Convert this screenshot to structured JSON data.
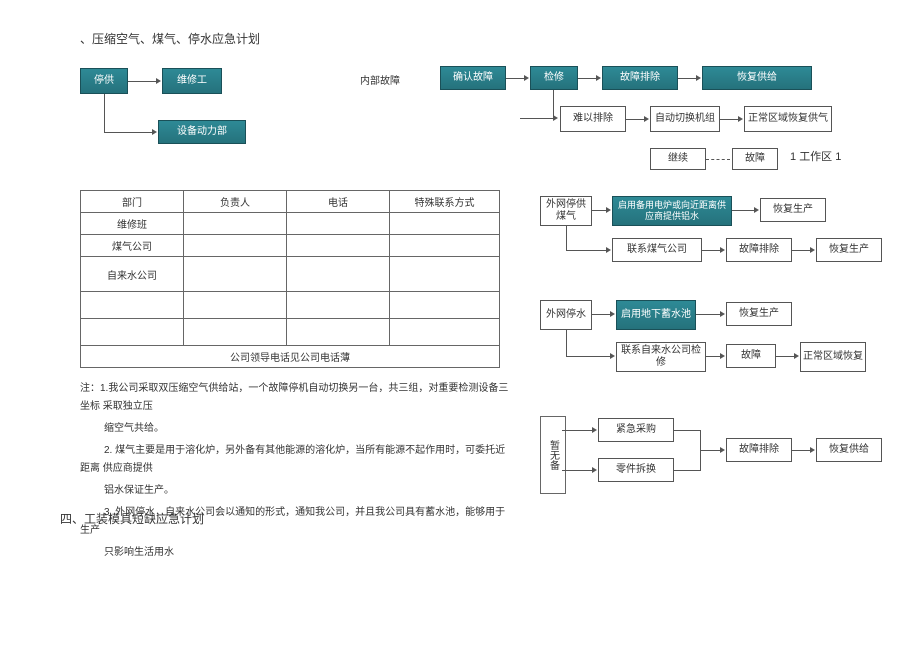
{
  "titles": {
    "main": "、压缩空气、煤气、停水应急计划",
    "section4": "四、工装模具短缺应急计划",
    "internal_fault": "内部故障"
  },
  "flow_left": {
    "supply_stop": "停供",
    "maintenance": "维修工",
    "equip_power": "设备动力部"
  },
  "flow_top": {
    "confirm_fault": "确认故障",
    "repair": "检修",
    "fault_remove": "故障排除",
    "restore_supply": "恢复供给",
    "hard_remove": "难以排除",
    "auto_switch": "自动切换机组",
    "normal_restore": "正常区域恢复供气",
    "continue": "继续",
    "fault": "故障",
    "gbz": "工作区"
  },
  "flow_gas": {
    "ext_gas_stop": "外网停供煤气",
    "backup": "启用备用电炉或向近距离供应商提供铝水",
    "restore": "恢复生产",
    "contact_gas": "联系煤气公司",
    "fault_remove": "故障排除",
    "restore2": "恢复生产"
  },
  "flow_water": {
    "ext_water_stop": "外网停水",
    "pool": "启用地下蓄水池",
    "restore": "恢复生产",
    "contact_water": "联系自来水公司检修",
    "fault": "故障",
    "normal_restore": "正常区域恢复"
  },
  "flow_spare": {
    "no_spare": "暂无备",
    "emergency_buy": "紧急采购",
    "part_remove": "零件拆换",
    "fault_remove": "故障排除",
    "restore": "恢复供给"
  },
  "table": {
    "headers": [
      "部门",
      "负责人",
      "电话",
      "特殊联系方式"
    ],
    "rows": [
      "维修班",
      "煤气公司",
      "自来水公司",
      "",
      ""
    ],
    "footnote": "公司领导电话见公司电话薄"
  },
  "notes": {
    "intro": "注：1.我公司采取双压缩空气供给站，一个故障停机自动切换另一台，共三组，对重要检测设备三坐标 采取独立压",
    "n1b": "缩空气共给。",
    "n2": "2. 煤气主要是用于溶化炉，另外备有其他能源的溶化炉，当所有能源不起作用时，可委托近距离 供应商提供",
    "n2b": "铝水保证生产。",
    "n3": "3. 外网停水，自来水公司会以通知的形式，通知我公司，并且我公司具有蓄水池，能够用于生产",
    "n3b": "只影响生活用水"
  }
}
